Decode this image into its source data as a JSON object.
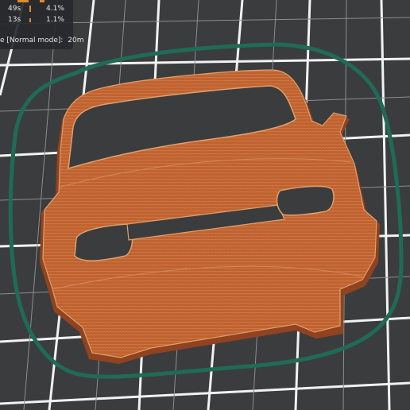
{
  "legend": {
    "rows": [
      {
        "time": "49s",
        "percent": "4.1%"
      },
      {
        "time": "13s",
        "percent": "1.1%"
      }
    ],
    "estimated_label": "e [Normal mode]:",
    "estimated_value": "20m"
  },
  "colors": {
    "bed": "#3b3c3e",
    "grid": "#f2f2f2",
    "skirt": "#1f6b55",
    "part": "#c0622f",
    "part_edge": "#8f4320",
    "part_line": "#e0a06a",
    "legend_accent": "#e08a2c"
  }
}
